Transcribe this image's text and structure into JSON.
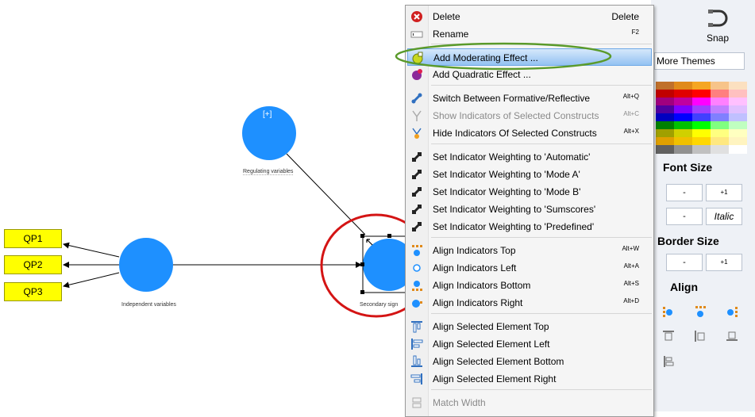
{
  "canvas": {
    "indicators": [
      "QP1",
      "QP2",
      "QP3"
    ],
    "nodes": {
      "regulating": {
        "caption": "Regulating variables",
        "expand_label": "[+]"
      },
      "independent": {
        "caption": "Independent variables"
      },
      "secondary": {
        "caption": "Secondary sign"
      }
    },
    "node_color": "#1e90ff",
    "indicator_color": "#ffff00"
  },
  "context_menu": {
    "items": [
      {
        "label": "Delete",
        "shortcut": "Delete",
        "icon": "delete-icon"
      },
      {
        "label": "Rename",
        "shortcut": "F2",
        "icon": "rename-icon"
      },
      {
        "label": "Add Moderating Effect ...",
        "shortcut": "",
        "icon": "moderating-effect-icon",
        "highlighted": true
      },
      {
        "label": "Add Quadratic Effect ...",
        "shortcut": "",
        "icon": "quadratic-effect-icon"
      },
      {
        "label": "Switch Between Formative/Reflective",
        "shortcut": "Alt+Q",
        "icon": "switch-icon"
      },
      {
        "label": "Show Indicators of Selected Constructs",
        "shortcut": "Alt+C",
        "icon": "show-indicators-icon",
        "disabled": true
      },
      {
        "label": "Hide Indicators Of Selected Constructs",
        "shortcut": "Alt+X",
        "icon": "hide-indicators-icon"
      },
      {
        "label": "Set Indicator Weighting to 'Automatic'",
        "shortcut": "",
        "icon": "weighting-icon"
      },
      {
        "label": "Set Indicator Weighting to 'Mode A'",
        "shortcut": "",
        "icon": "weighting-icon"
      },
      {
        "label": "Set Indicator Weighting to 'Mode B'",
        "shortcut": "",
        "icon": "weighting-icon"
      },
      {
        "label": "Set Indicator Weighting to 'Sumscores'",
        "shortcut": "",
        "icon": "weighting-icon"
      },
      {
        "label": "Set Indicator Weighting to 'Predefined'",
        "shortcut": "",
        "icon": "weighting-icon"
      },
      {
        "label": "Align Indicators Top",
        "shortcut": "Alt+W",
        "icon": "align-indicators-top-icon"
      },
      {
        "label": "Align Indicators Left",
        "shortcut": "Alt+A",
        "icon": "align-indicators-left-icon"
      },
      {
        "label": "Align Indicators Bottom",
        "shortcut": "Alt+S",
        "icon": "align-indicators-bottom-icon"
      },
      {
        "label": "Align Indicators Right",
        "shortcut": "Alt+D",
        "icon": "align-indicators-right-icon"
      },
      {
        "label": "Align Selected Element Top",
        "shortcut": "",
        "icon": "align-element-top-icon"
      },
      {
        "label": "Align Selected Element Left",
        "shortcut": "",
        "icon": "align-element-left-icon"
      },
      {
        "label": "Align Selected Element Bottom",
        "shortcut": "",
        "icon": "align-element-bottom-icon"
      },
      {
        "label": "Align Selected Element Right",
        "shortcut": "",
        "icon": "align-element-right-icon"
      },
      {
        "label": "Match Width",
        "shortcut": "",
        "icon": "match-width-icon",
        "disabled": true
      }
    ]
  },
  "right_panel": {
    "snap_label": "Snap",
    "more_themes_label": "More Themes",
    "font_size_title": "Font Size",
    "border_size_title": "Border Size",
    "align_title": "Align",
    "minus_label": "-",
    "plus_one_label": "+1",
    "italic_label": "Italic",
    "palette_rows": [
      [
        "#c0702a",
        "#e08a1a",
        "#f5a623",
        "#f7c48a",
        "#fbe0c0"
      ],
      [
        "#c00000",
        "#e00000",
        "#ff0000",
        "#ff7f7f",
        "#ffc0c0"
      ],
      [
        "#a0007f",
        "#c000a0",
        "#ff00ff",
        "#ff80ff",
        "#ffc0ff"
      ],
      [
        "#5000a0",
        "#7f00ff",
        "#a040ff",
        "#c080ff",
        "#e0c0ff"
      ],
      [
        "#0000c0",
        "#0000ff",
        "#4040ff",
        "#8080ff",
        "#c0c0ff"
      ],
      [
        "#008000",
        "#00c000",
        "#00ff00",
        "#80ff80",
        "#c0ffc0"
      ],
      [
        "#a0a000",
        "#d0d000",
        "#ffff00",
        "#ffff80",
        "#ffffc0"
      ],
      [
        "#e0a000",
        "#f0c000",
        "#ffd700",
        "#ffe880",
        "#fff4c0"
      ],
      [
        "#606060",
        "#909090",
        "#c0c0c0",
        "#e0e0e0",
        "#ffffff"
      ]
    ]
  },
  "annotations": {
    "green_color": "#5a9a2a",
    "red_color": "#d41414"
  }
}
